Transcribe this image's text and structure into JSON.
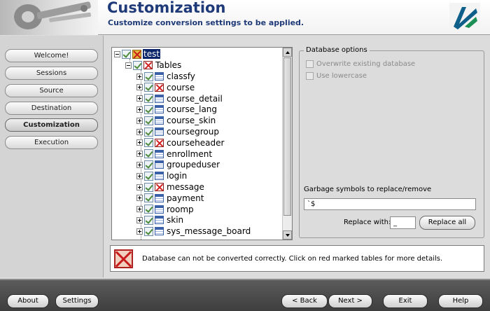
{
  "header": {
    "title": "Customization",
    "subtitle": "Customize conversion settings to be applied."
  },
  "sidebar": {
    "items": [
      {
        "label": "Welcome!",
        "active": false
      },
      {
        "label": "Sessions",
        "active": false
      },
      {
        "label": "Source",
        "active": false
      },
      {
        "label": "Destination",
        "active": false
      },
      {
        "label": "Customization",
        "active": true
      },
      {
        "label": "Execution",
        "active": false
      }
    ]
  },
  "tree": {
    "root": "test",
    "group": "Tables",
    "tables": [
      {
        "name": "classfy",
        "error": false
      },
      {
        "name": "course",
        "error": true
      },
      {
        "name": "course_detail",
        "error": false
      },
      {
        "name": "course_lang",
        "error": false
      },
      {
        "name": "course_skin",
        "error": false
      },
      {
        "name": "coursegroup",
        "error": false
      },
      {
        "name": "courseheader",
        "error": true
      },
      {
        "name": "enrollment",
        "error": false
      },
      {
        "name": "groupeduser",
        "error": false
      },
      {
        "name": "login",
        "error": false
      },
      {
        "name": "message",
        "error": true
      },
      {
        "name": "payment",
        "error": false
      },
      {
        "name": "roomp",
        "error": false
      },
      {
        "name": "skin",
        "error": false
      },
      {
        "name": "sys_message_board",
        "error": false
      }
    ]
  },
  "options": {
    "legend": "Database options",
    "overwrite_label": "Overwrite existing database",
    "lowercase_label": "Use lowercase",
    "garbage_label": "Garbage symbols to replace/remove",
    "garbage_value": "`$",
    "replace_label": "Replace with:",
    "replace_value": "_",
    "replace_all_label": "Replace all"
  },
  "status": {
    "message": "Database can not be converted correctly. Click on red marked tables for more details."
  },
  "footer": {
    "about": "About",
    "settings": "Settings",
    "back": "< Back",
    "next": "Next >",
    "exit": "Exit",
    "help": "Help"
  },
  "colors": {
    "title": "#1f3a78",
    "error": "#c81c1c",
    "selection": "#0a246a"
  }
}
